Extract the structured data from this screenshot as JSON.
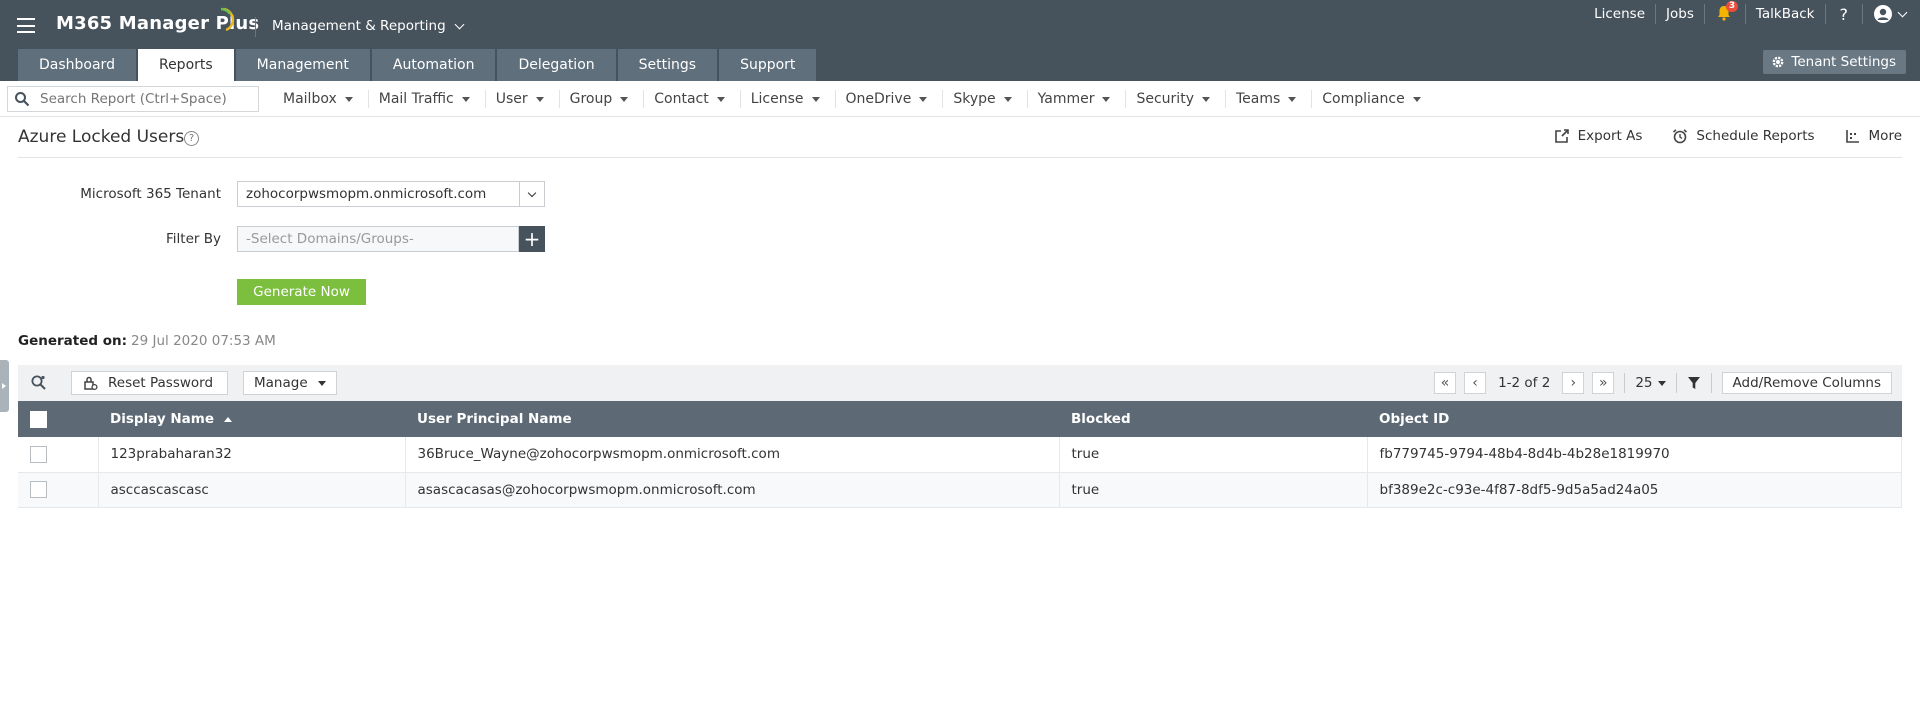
{
  "header": {
    "app_name": "M365 Manager Plus",
    "app_menu": "Management & Reporting",
    "top_links": {
      "license": "License",
      "jobs": "Jobs",
      "notification_count": "3",
      "talkback": "TalkBack",
      "help": "?"
    },
    "tenant_settings": "Tenant Settings"
  },
  "tabs": [
    {
      "label": "Dashboard"
    },
    {
      "label": "Reports"
    },
    {
      "label": "Management"
    },
    {
      "label": "Automation"
    },
    {
      "label": "Delegation"
    },
    {
      "label": "Settings"
    },
    {
      "label": "Support"
    }
  ],
  "search": {
    "placeholder": "Search Report (Ctrl+Space)"
  },
  "submenu": [
    {
      "label": "Mailbox"
    },
    {
      "label": "Mail Traffic"
    },
    {
      "label": "User"
    },
    {
      "label": "Group"
    },
    {
      "label": "Contact"
    },
    {
      "label": "License"
    },
    {
      "label": "OneDrive"
    },
    {
      "label": "Skype"
    },
    {
      "label": "Yammer"
    },
    {
      "label": "Security"
    },
    {
      "label": "Teams"
    },
    {
      "label": "Compliance"
    }
  ],
  "page": {
    "title": "Azure Locked Users",
    "help": "?",
    "actions": {
      "export": "Export As",
      "schedule": "Schedule Reports",
      "more": "More"
    }
  },
  "form": {
    "tenant_label": "Microsoft 365 Tenant",
    "tenant_value": "zohocorpwsmopm.onmicrosoft.com",
    "filter_label": "Filter By",
    "filter_placeholder": "-Select Domains/Groups-",
    "filter_plus": "+",
    "generate": "Generate Now"
  },
  "generated": {
    "label": "Generated on:",
    "value": "29 Jul 2020 07:53 AM"
  },
  "toolbar": {
    "reset_password": "Reset Password",
    "manage": "Manage",
    "page_info": "1-2 of 2",
    "page_size": "25",
    "columns": "Add/Remove Columns"
  },
  "table": {
    "columns": [
      "Display Name",
      "User Principal Name",
      "Blocked",
      "Object ID"
    ],
    "rows": [
      {
        "display_name": "123prabaharan32",
        "upn": "36Bruce_Wayne@zohocorpwsmopm.onmicrosoft.com",
        "blocked": "true",
        "object_id": "fb779745-9794-48b4-8d4b-4b28e1819970"
      },
      {
        "display_name": "asccascascasc",
        "upn": "asascacasas@zohocorpwsmopm.onmicrosoft.com",
        "blocked": "true",
        "object_id": "bf389e2c-c93e-4f87-8df5-9d5a5ad24a05"
      }
    ]
  },
  "colors": {
    "header_bg": "#46525c",
    "tab_bg": "#5f6f7c",
    "generate_green": "#7cbf3f",
    "table_header": "#5d6a75",
    "badge_red": "#e74c3c"
  }
}
